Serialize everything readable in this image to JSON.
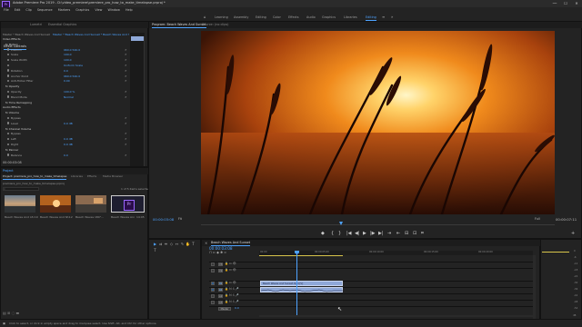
{
  "app": {
    "title": "Adobe Premiere Pro 2019 - D:\\video_premiere\\premiere_pro_how_to_make_timelapse.prproj *",
    "icon_label": "Pr"
  },
  "window_controls": [
    "—",
    "☐",
    "✕"
  ],
  "menu": [
    "File",
    "Edit",
    "Clip",
    "Sequence",
    "Markers",
    "Graphics",
    "View",
    "Window",
    "Help"
  ],
  "workspaces": [
    "Learning",
    "Assembly",
    "Editing",
    "Color",
    "Effects",
    "Audio",
    "Graphics",
    "Libraries",
    "Editing"
  ],
  "workspace_active_index": 8,
  "effect_controls": {
    "tabs": [
      "Effect Controls",
      "Lumetri",
      "Essential Graphics"
    ],
    "clip_header": "Master * Beach Waves And Sunset * Beach Waves And Sunset",
    "sections": [
      {
        "label": "Video Effects",
        "kind": "header"
      },
      {
        "label": "fx  Motion",
        "kind": "group"
      },
      {
        "label": "Position",
        "value": "960.0  540.0"
      },
      {
        "label": "Scale",
        "value": "100.0"
      },
      {
        "label": "Scale Width",
        "value": "100.0"
      },
      {
        "label": "",
        "value": "Uniform Scale"
      },
      {
        "label": "Rotation",
        "value": "0.0"
      },
      {
        "label": "Anchor Point",
        "value": "960.0  540.0"
      },
      {
        "label": "Anti-flicker Filter",
        "value": "0.00"
      },
      {
        "label": "fx  Opacity",
        "kind": "group"
      },
      {
        "label": "Opacity",
        "value": "100.0 %"
      },
      {
        "label": "Blend Mode",
        "value": "Normal"
      },
      {
        "label": "fx  Time Remapping",
        "kind": "group"
      },
      {
        "label": "Audio Effects",
        "kind": "header"
      },
      {
        "label": "fx  Volume",
        "kind": "group"
      },
      {
        "label": "Bypass",
        "value": ""
      },
      {
        "label": "Level",
        "value": "0.0 dB"
      },
      {
        "label": "fx  Channel Volume",
        "kind": "group"
      },
      {
        "label": "Bypass",
        "value": ""
      },
      {
        "label": "Left",
        "value": "0.0 dB"
      },
      {
        "label": "Right",
        "value": "0.0 dB"
      },
      {
        "label": "fx  Panner",
        "kind": "group"
      },
      {
        "label": "Balance",
        "value": "0.0"
      }
    ],
    "timecode": "00:00:03:08"
  },
  "project": {
    "tabs": [
      "Project: premiere_pro_how_to_make_timelapse",
      "Libraries",
      "Effects",
      "Media Browser"
    ],
    "path": "premiere_pro_how_to_make_timelapse.prproj",
    "search_placeholder": "",
    "count": "1 of 5 items selected",
    "items": [
      {
        "name": "Beach Waves And ...",
        "duration": "15:19"
      },
      {
        "name": "Beach Waves And S...",
        "duration": "7:12"
      },
      {
        "name": "Beach Waves 180°...",
        "duration": "14:05"
      },
      {
        "name": "Beach Waves And Sunset",
        "duration": "14:05"
      }
    ]
  },
  "program": {
    "tabs": [
      "Program: Beach Waves And Sunset",
      "Source: (no clips)"
    ],
    "timecode_in": "00:00:03:08",
    "fit": "Fit",
    "quality": "Full",
    "timecode_total": "00:00:07:11",
    "controls": [
      "◆",
      "{",
      "}",
      "|◀",
      "◀|",
      "▶",
      "|▶",
      "▶|",
      "⇥",
      "⇤",
      "⊟",
      "⊡",
      "⌗"
    ]
  },
  "timeline": {
    "tab": "Beach Waves And Sunset",
    "timecode": "00:00:03:08",
    "ruler_labels": [
      "00:00",
      "00:00:05:00",
      "00:00:10:00",
      "00:00:15:00",
      "00:00:20:00"
    ],
    "tracks": [
      {
        "name": "V3"
      },
      {
        "name": "V2"
      },
      {
        "name": "V1"
      },
      {
        "name": "A1"
      },
      {
        "name": "A2"
      },
      {
        "name": "A3"
      },
      {
        "name": "Master",
        "value": "0.0"
      }
    ],
    "video_clip": "Beach Waves And Sunset.mp4 [V]",
    "audio_clip": ""
  },
  "audio_meter": {
    "labels": [
      "0",
      "-6",
      "-12",
      "-18",
      "-24",
      "-30",
      "-36",
      "-42",
      "-48",
      "-54"
    ],
    "db": "dB"
  },
  "status": "Click to select, or click in empty space and drag to marquee select. Use Shift, Alt, and Ctrl for other options.",
  "colors": {
    "accent": "#4ea3ff",
    "clip_video": "#8fa8d8",
    "playhead": "#4ea3ff"
  }
}
